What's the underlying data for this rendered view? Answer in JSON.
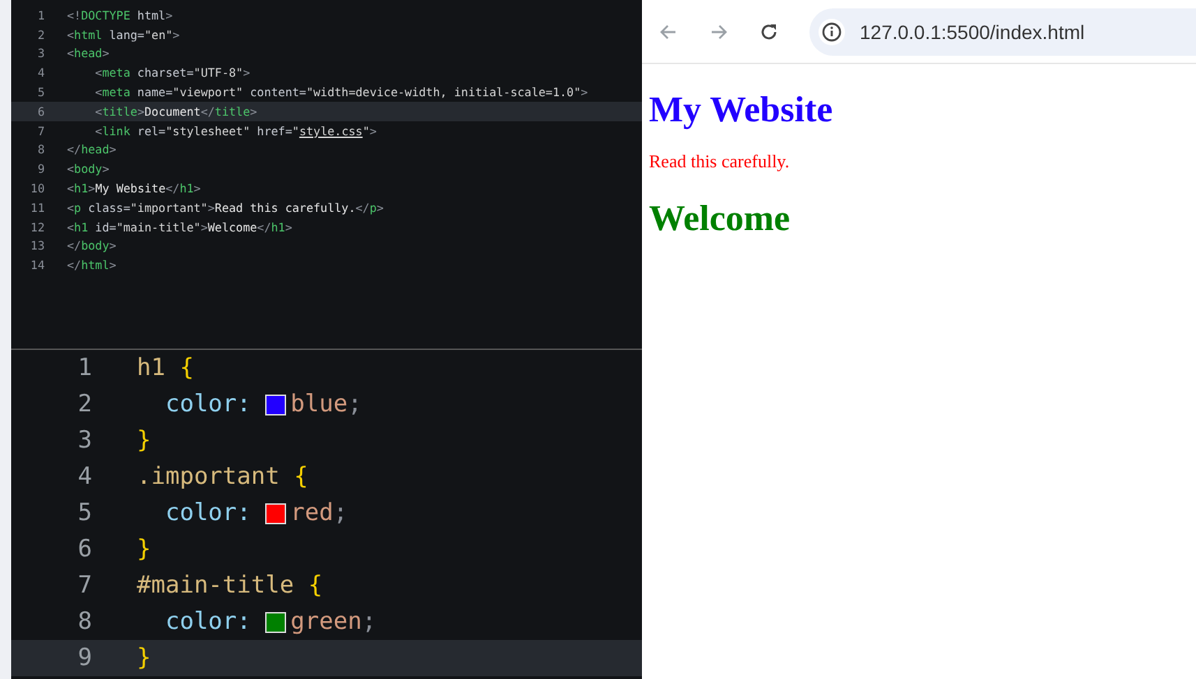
{
  "html_editor": {
    "lines": [
      {
        "number": "1",
        "current": false,
        "tokens": [
          {
            "kind": "punct",
            "text": "<!"
          },
          {
            "kind": "tag",
            "text": "DOCTYPE"
          },
          {
            "kind": "attr",
            "text": " html"
          },
          {
            "kind": "punct",
            "text": ">"
          }
        ]
      },
      {
        "number": "2",
        "current": false,
        "tokens": [
          {
            "kind": "punct",
            "text": "<"
          },
          {
            "kind": "tag",
            "text": "html"
          },
          {
            "kind": "attr",
            "text": " lang="
          },
          {
            "kind": "str",
            "text": "\"en\""
          },
          {
            "kind": "punct",
            "text": ">"
          }
        ]
      },
      {
        "number": "3",
        "current": false,
        "tokens": [
          {
            "kind": "punct",
            "text": "<"
          },
          {
            "kind": "tag",
            "text": "head"
          },
          {
            "kind": "punct",
            "text": ">"
          }
        ]
      },
      {
        "number": "4",
        "current": false,
        "tokens": [
          {
            "kind": "punct",
            "text": "    <"
          },
          {
            "kind": "tag",
            "text": "meta"
          },
          {
            "kind": "attr",
            "text": " charset="
          },
          {
            "kind": "str",
            "text": "\"UTF-8\""
          },
          {
            "kind": "punct",
            "text": ">"
          }
        ]
      },
      {
        "number": "5",
        "current": false,
        "tokens": [
          {
            "kind": "punct",
            "text": "    <"
          },
          {
            "kind": "tag",
            "text": "meta"
          },
          {
            "kind": "attr",
            "text": " name="
          },
          {
            "kind": "str",
            "text": "\"viewport\""
          },
          {
            "kind": "attr",
            "text": " content="
          },
          {
            "kind": "str",
            "text": "\"width=device-width, initial-scale=1.0\""
          },
          {
            "kind": "punct",
            "text": ">"
          }
        ]
      },
      {
        "number": "6",
        "current": true,
        "tokens": [
          {
            "kind": "punct",
            "text": "    <"
          },
          {
            "kind": "tag",
            "text": "title"
          },
          {
            "kind": "punct",
            "text": ">"
          },
          {
            "kind": "text",
            "text": "Document"
          },
          {
            "kind": "punct",
            "text": "</"
          },
          {
            "kind": "tag",
            "text": "title"
          },
          {
            "kind": "punct",
            "text": ">"
          }
        ]
      },
      {
        "number": "7",
        "current": false,
        "tokens": [
          {
            "kind": "punct",
            "text": "    <"
          },
          {
            "kind": "tag",
            "text": "link"
          },
          {
            "kind": "attr",
            "text": " rel="
          },
          {
            "kind": "str",
            "text": "\"stylesheet\""
          },
          {
            "kind": "attr",
            "text": " href="
          },
          {
            "kind": "str",
            "text": "\""
          },
          {
            "kind": "link",
            "text": "style.css"
          },
          {
            "kind": "str",
            "text": "\""
          },
          {
            "kind": "punct",
            "text": ">"
          }
        ]
      },
      {
        "number": "8",
        "current": false,
        "tokens": [
          {
            "kind": "punct",
            "text": "</"
          },
          {
            "kind": "tag",
            "text": "head"
          },
          {
            "kind": "punct",
            "text": ">"
          }
        ]
      },
      {
        "number": "9",
        "current": false,
        "tokens": [
          {
            "kind": "punct",
            "text": "<"
          },
          {
            "kind": "tag",
            "text": "body"
          },
          {
            "kind": "punct",
            "text": ">"
          }
        ]
      },
      {
        "number": "10",
        "current": false,
        "tokens": [
          {
            "kind": "punct",
            "text": "<"
          },
          {
            "kind": "tag",
            "text": "h1"
          },
          {
            "kind": "punct",
            "text": ">"
          },
          {
            "kind": "text",
            "text": "My Website"
          },
          {
            "kind": "punct",
            "text": "</"
          },
          {
            "kind": "tag",
            "text": "h1"
          },
          {
            "kind": "punct",
            "text": ">"
          }
        ]
      },
      {
        "number": "11",
        "current": false,
        "tokens": [
          {
            "kind": "punct",
            "text": "<"
          },
          {
            "kind": "tag",
            "text": "p"
          },
          {
            "kind": "attr",
            "text": " class="
          },
          {
            "kind": "str",
            "text": "\"important\""
          },
          {
            "kind": "punct",
            "text": ">"
          },
          {
            "kind": "text",
            "text": "Read this carefully."
          },
          {
            "kind": "punct",
            "text": "</"
          },
          {
            "kind": "tag",
            "text": "p"
          },
          {
            "kind": "punct",
            "text": ">"
          }
        ]
      },
      {
        "number": "12",
        "current": false,
        "tokens": [
          {
            "kind": "punct",
            "text": "<"
          },
          {
            "kind": "tag",
            "text": "h1"
          },
          {
            "kind": "attr",
            "text": " id="
          },
          {
            "kind": "str",
            "text": "\"main-title\""
          },
          {
            "kind": "punct",
            "text": ">"
          },
          {
            "kind": "text",
            "text": "Welcome"
          },
          {
            "kind": "punct",
            "text": "</"
          },
          {
            "kind": "tag",
            "text": "h1"
          },
          {
            "kind": "punct",
            "text": ">"
          }
        ]
      },
      {
        "number": "13",
        "current": false,
        "tokens": [
          {
            "kind": "punct",
            "text": "</"
          },
          {
            "kind": "tag",
            "text": "body"
          },
          {
            "kind": "punct",
            "text": ">"
          }
        ]
      },
      {
        "number": "14",
        "current": false,
        "tokens": [
          {
            "kind": "punct",
            "text": "</"
          },
          {
            "kind": "tag",
            "text": "html"
          },
          {
            "kind": "punct",
            "text": ">"
          }
        ]
      }
    ]
  },
  "css_editor": {
    "lines": [
      {
        "number": "1",
        "current": false,
        "tokens": [
          {
            "kind": "sel",
            "text": "h1 "
          },
          {
            "kind": "brace",
            "text": "{"
          }
        ]
      },
      {
        "number": "2",
        "current": false,
        "tokens": [
          {
            "kind": "prop",
            "text": "  color: "
          }
        ],
        "swatch": {
          "color": "#2200ff"
        },
        "after": [
          {
            "kind": "val",
            "text": "blue"
          },
          {
            "kind": "punct",
            "text": ";"
          }
        ]
      },
      {
        "number": "3",
        "current": false,
        "tokens": [
          {
            "kind": "brace",
            "text": "}"
          }
        ]
      },
      {
        "number": "4",
        "current": false,
        "tokens": [
          {
            "kind": "sel",
            "text": ".important "
          },
          {
            "kind": "brace",
            "text": "{"
          }
        ]
      },
      {
        "number": "5",
        "current": false,
        "tokens": [
          {
            "kind": "prop",
            "text": "  color: "
          }
        ],
        "swatch": {
          "color": "#ff0000"
        },
        "after": [
          {
            "kind": "val",
            "text": "red"
          },
          {
            "kind": "punct",
            "text": ";"
          }
        ]
      },
      {
        "number": "6",
        "current": false,
        "tokens": [
          {
            "kind": "brace",
            "text": "}"
          }
        ]
      },
      {
        "number": "7",
        "current": false,
        "tokens": [
          {
            "kind": "sel",
            "text": "#main-title "
          },
          {
            "kind": "brace",
            "text": "{"
          }
        ]
      },
      {
        "number": "8",
        "current": false,
        "tokens": [
          {
            "kind": "prop",
            "text": "  color: "
          }
        ],
        "swatch": {
          "color": "#008000"
        },
        "after": [
          {
            "kind": "val",
            "text": "green"
          },
          {
            "kind": "punct",
            "text": ";"
          }
        ]
      },
      {
        "number": "9",
        "current": true,
        "tokens": [
          {
            "kind": "brace",
            "text": "}"
          }
        ]
      }
    ]
  },
  "browser": {
    "url": "127.0.0.1:5500/index.html",
    "page": [
      {
        "kind": "heading",
        "text": "My Website",
        "color": "#2200ff"
      },
      {
        "kind": "paragraph",
        "text": "Read this carefully.",
        "color": "#ff0000"
      },
      {
        "kind": "heading",
        "text": "Welcome",
        "color": "#008000"
      }
    ]
  }
}
